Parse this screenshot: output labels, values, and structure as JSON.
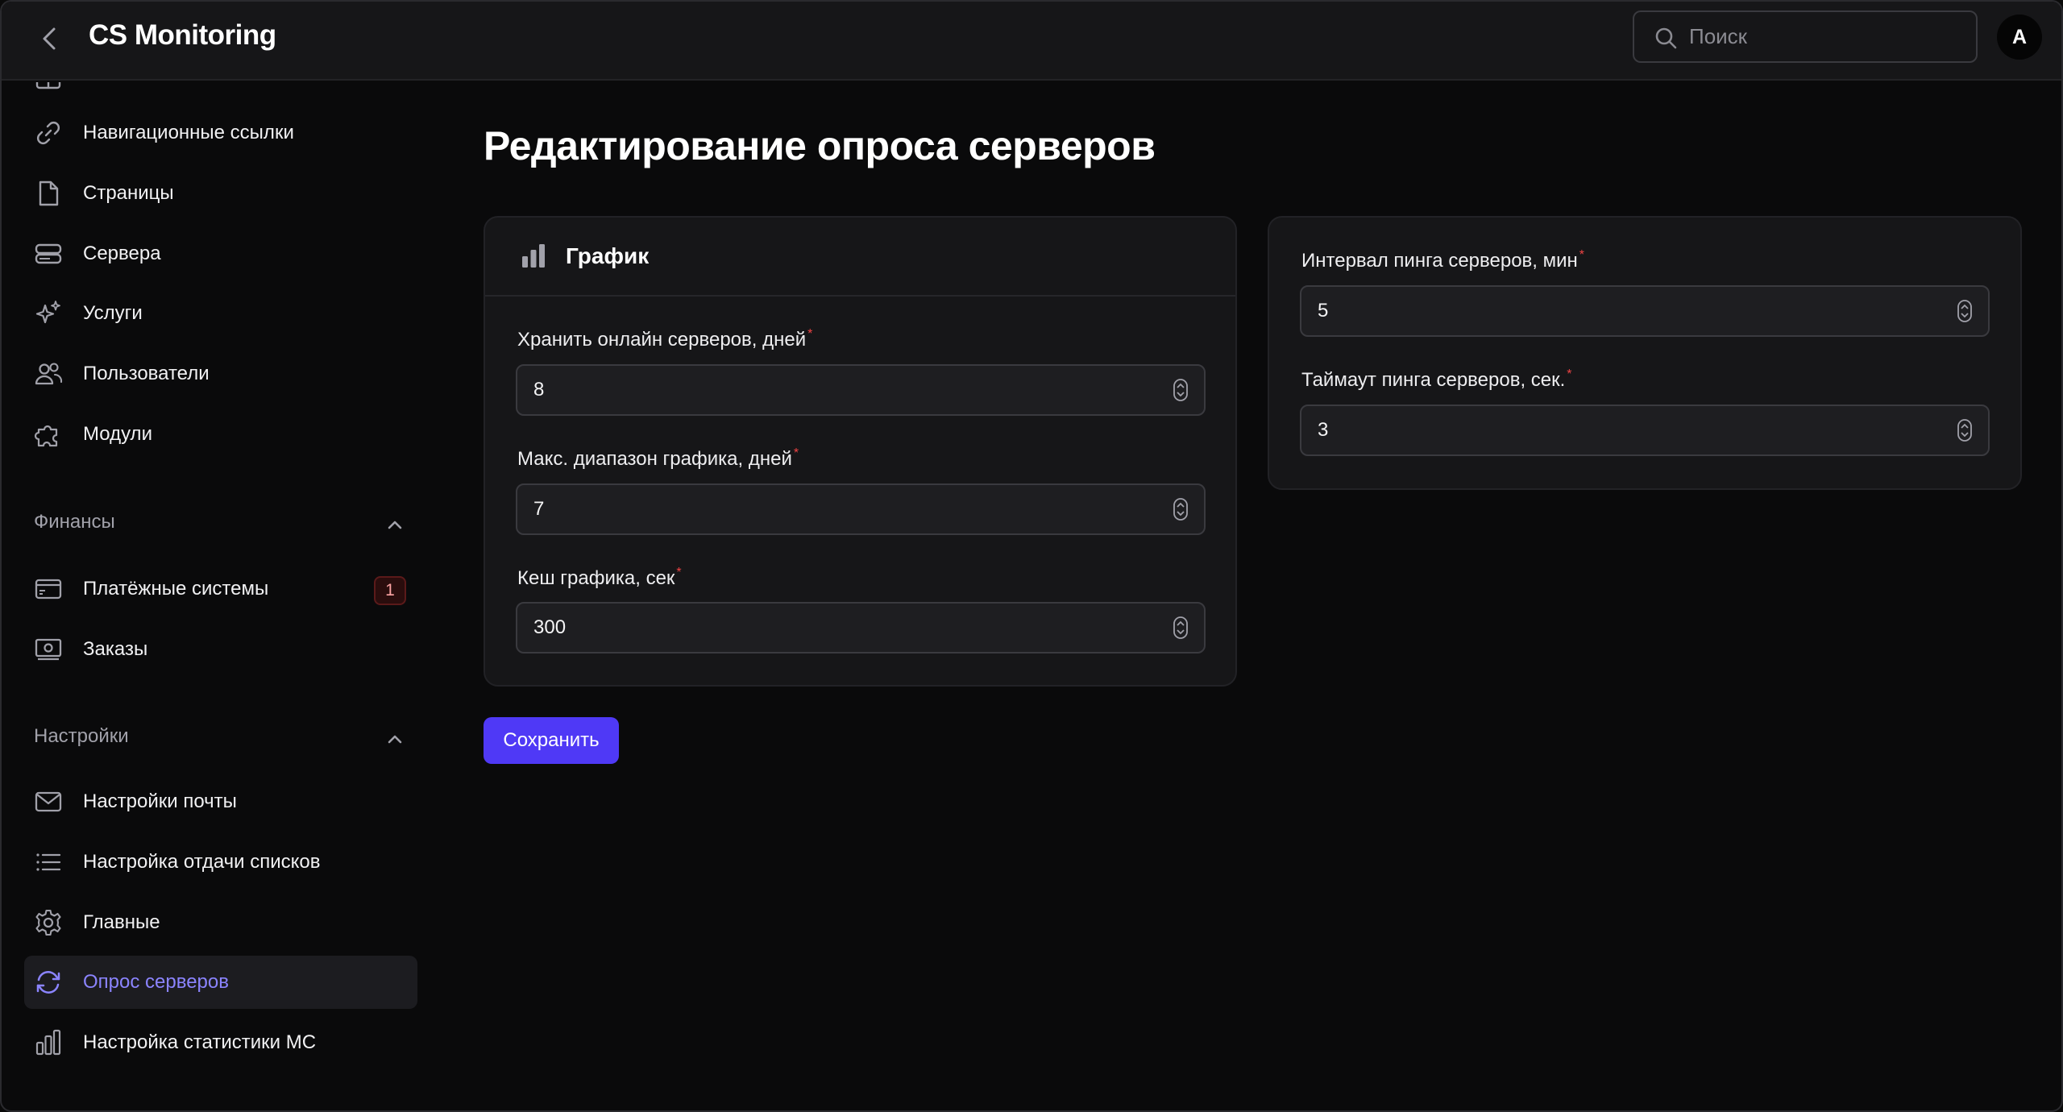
{
  "app": {
    "title": "CS Monitoring",
    "search_placeholder": "Поиск",
    "avatar_initial": "A"
  },
  "sidebar": {
    "top_items": [
      {
        "label": "Навигационные ссылки",
        "icon": "link-icon"
      },
      {
        "label": "Страницы",
        "icon": "document-icon"
      },
      {
        "label": "Сервера",
        "icon": "server-icon"
      },
      {
        "label": "Услуги",
        "icon": "sparkles-icon"
      },
      {
        "label": "Пользователи",
        "icon": "users-icon"
      },
      {
        "label": "Модули",
        "icon": "puzzle-icon"
      }
    ],
    "finance": {
      "title": "Финансы",
      "items": [
        {
          "label": "Платёжные системы",
          "icon": "credit-card-icon",
          "badge": "1"
        },
        {
          "label": "Заказы",
          "icon": "banknote-icon"
        }
      ]
    },
    "settings": {
      "title": "Настройки",
      "items": [
        {
          "label": "Настройки почты",
          "icon": "envelope-icon"
        },
        {
          "label": "Настройка отдачи списков",
          "icon": "list-icon"
        },
        {
          "label": "Главные",
          "icon": "gear-icon"
        },
        {
          "label": "Опрос серверов",
          "icon": "refresh-icon",
          "active": true
        },
        {
          "label": "Настройка статистики МС",
          "icon": "bar-chart-icon"
        }
      ]
    }
  },
  "main": {
    "page_title": "Редактирование опроса серверов",
    "chart_section": {
      "title": "График",
      "fields": [
        {
          "label": "Хранить онлайн серверов, дней",
          "value": "8",
          "required": true
        },
        {
          "label": "Макс. диапазон графика, дней",
          "value": "7",
          "required": true
        },
        {
          "label": "Кеш графика, сек",
          "value": "300",
          "required": true
        }
      ]
    },
    "ping_section": {
      "fields": [
        {
          "label": "Интервал пинга серверов, мин",
          "value": "5",
          "required": true
        },
        {
          "label": "Таймаут пинга серверов, сек.",
          "value": "3",
          "required": true
        }
      ]
    },
    "save_label": "Сохранить",
    "required_mark": "*"
  },
  "colors": {
    "accent": "#4f39f6",
    "active_text": "#8b84ff",
    "required": "#ef4444",
    "background": "#0a0a0a",
    "card": "#161618"
  }
}
